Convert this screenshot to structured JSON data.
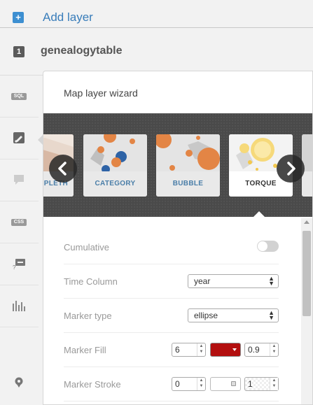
{
  "topbar": {
    "add_icon": "+",
    "add_label": "Add layer"
  },
  "layer": {
    "number": "1",
    "name": "genealogytable"
  },
  "sidebar": {
    "tools": [
      {
        "name": "sql",
        "icon": "SQL",
        "tag": true
      },
      {
        "name": "wizard",
        "icon": "brush-icon",
        "tag": false
      },
      {
        "name": "infowindow",
        "icon": "speech-bubble-icon",
        "tag": false
      },
      {
        "name": "css",
        "icon": "CSS",
        "tag": true
      },
      {
        "name": "legends",
        "icon": "legend-icon",
        "tag": false
      },
      {
        "name": "filters",
        "icon": "histogram-icon",
        "tag": false
      },
      {
        "name": "add-layer",
        "icon": "pin-icon",
        "tag": false
      }
    ]
  },
  "panel": {
    "title": "Map layer wizard",
    "cards": [
      {
        "label": "PLETH",
        "selected": false
      },
      {
        "label": "CATEGORY",
        "selected": false
      },
      {
        "label": "BUBBLE",
        "selected": false
      },
      {
        "label": "TORQUE",
        "selected": true
      }
    ],
    "prev_icon": "chevron-left-icon",
    "next_icon": "chevron-right-icon"
  },
  "form": {
    "cumulative_label": "Cumulative",
    "cumulative_on": false,
    "time_column_label": "Time Column",
    "time_column_value": "year",
    "marker_type_label": "Marker type",
    "marker_type_value": "ellipse",
    "marker_fill_label": "Marker Fill",
    "marker_fill_size": "6",
    "marker_fill_color": "#b30f0f",
    "marker_fill_opacity": "0.9",
    "marker_stroke_label": "Marker Stroke",
    "marker_stroke_width": "0",
    "marker_stroke_opacity": "1"
  },
  "colors": {
    "accent": "#397dba",
    "selected_card_bg": "#ffffff",
    "carousel_bg": "#4a4a4a"
  }
}
